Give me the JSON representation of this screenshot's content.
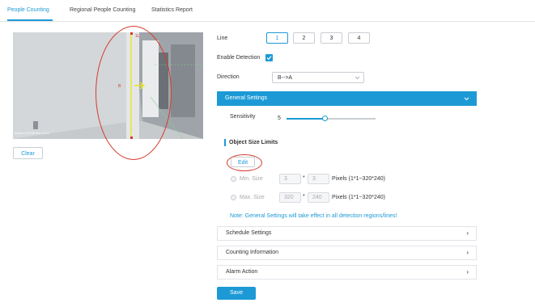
{
  "tabs": [
    "People Counting",
    "Regional People Counting",
    "Statistics Report"
  ],
  "video": {
    "overlay_timestamp": "Ipcam 1:00:00 Ecr 1:2:1",
    "line_start_label": "1L",
    "line_direction_label": "B"
  },
  "clear_label": "Clear",
  "line": {
    "label": "Line",
    "options": [
      "1",
      "2",
      "3",
      "4"
    ],
    "selected": "1"
  },
  "enable_detection": {
    "label": "Enable Detection",
    "checked": true
  },
  "direction": {
    "label": "Direction",
    "value": "B-->A"
  },
  "general_settings": {
    "title": "General Settings"
  },
  "sensitivity": {
    "label": "Sensitivity",
    "value": "5",
    "level_fraction": 0.44
  },
  "object_size": {
    "title": "Object Size Limits",
    "edit_label": "Edit",
    "min": {
      "label": "Min. Size",
      "w": "3",
      "h": "3",
      "units": "Pixels (1*1~320*240)"
    },
    "max": {
      "label": "Max. Size",
      "w": "320",
      "h": "240",
      "units": "Pixels (1*1~320*240)"
    },
    "times": "*"
  },
  "note": "Note: General Settings will take effect in all detection regions/lines!",
  "sections": [
    "Schedule Settings",
    "Counting Information",
    "Alarm Action"
  ],
  "save_label": "Save",
  "colors": {
    "accent": "#1d9ad6",
    "annotation": "#d23b2a",
    "detection_line": "#e8e81a"
  }
}
